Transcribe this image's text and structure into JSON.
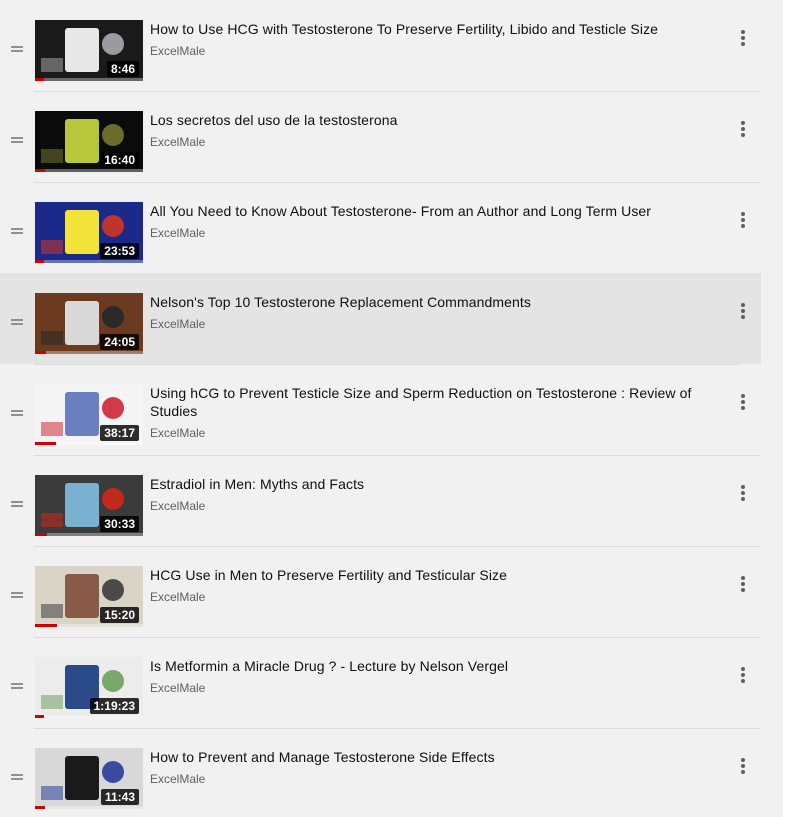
{
  "playlist": {
    "items": [
      {
        "title": "How to Use HCG with Testosterone To Preserve Fertility, Libido and Testicle Size",
        "channel": "ExcelMale",
        "duration": "8:46",
        "watched_fraction": 0.08,
        "active": false,
        "thumb_colors": [
          "#1a1a1a",
          "#e8e8e8",
          "#9a9aa0"
        ]
      },
      {
        "title": "Los secretos del uso de la testosterona",
        "channel": "ExcelMale",
        "duration": "16:40",
        "watched_fraction": 0.09,
        "active": false,
        "thumb_colors": [
          "#0b0b0b",
          "#b8c63a",
          "#6b6b2a"
        ]
      },
      {
        "title": "All You Need to Know About Testosterone- From an Author and Long Term User",
        "channel": "ExcelMale",
        "duration": "23:53",
        "watched_fraction": 0.08,
        "active": false,
        "thumb_colors": [
          "#1b2a8a",
          "#f3e43a",
          "#c0352b"
        ]
      },
      {
        "title": "Nelson's Top 10 Testosterone Replacement Commandments",
        "channel": "ExcelMale",
        "duration": "24:05",
        "watched_fraction": 0.1,
        "active": true,
        "thumb_colors": [
          "#6b3a1f",
          "#d9d9d9",
          "#2a2a2a"
        ]
      },
      {
        "title": "Using hCG to Prevent Testicle Size and Sperm Reduction on Testosterone : Review of Studies",
        "channel": "ExcelMale",
        "duration": "38:17",
        "watched_fraction": 0.19,
        "active": false,
        "thumb_colors": [
          "#f4f4f4",
          "#6a7fc0",
          "#d23a4a"
        ]
      },
      {
        "title": "Estradiol in Men: Myths and Facts",
        "channel": "ExcelMale",
        "duration": "30:33",
        "watched_fraction": 0.11,
        "active": false,
        "thumb_colors": [
          "#3b3b3b",
          "#7ab0d0",
          "#c2281e"
        ]
      },
      {
        "title": "HCG Use in Men to Preserve Fertility and Testicular Size",
        "channel": "ExcelMale",
        "duration": "15:20",
        "watched_fraction": 0.2,
        "active": false,
        "thumb_colors": [
          "#d9d4c6",
          "#8a5a48",
          "#4a4a4a"
        ]
      },
      {
        "title": "Is Metformin a Miracle Drug ? - Lecture by Nelson Vergel",
        "channel": "ExcelMale",
        "duration": "1:19:23",
        "watched_fraction": 0.08,
        "active": false,
        "thumb_colors": [
          "#ececec",
          "#2a4a8a",
          "#7aa86a"
        ]
      },
      {
        "title": "How to Prevent and Manage Testosterone Side Effects",
        "channel": "ExcelMale",
        "duration": "11:43",
        "watched_fraction": 0.09,
        "active": false,
        "thumb_colors": [
          "#d8d8d8",
          "#1a1a1a",
          "#3a4aa0"
        ]
      }
    ]
  },
  "colors": {
    "accent": "#cc0000",
    "background": "#f1f1f1",
    "active_row": "#e4e4e4"
  },
  "icons": {
    "drag": "drag-handle-icon",
    "menu": "more-vert-icon"
  }
}
